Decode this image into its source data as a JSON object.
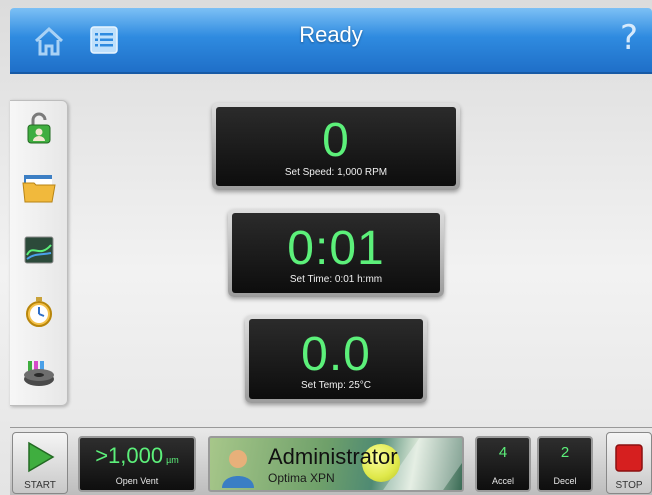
{
  "header": {
    "title": "Ready",
    "home_icon": "home-icon",
    "list_icon": "list-icon",
    "help_label": "?"
  },
  "sidebar": {
    "items": [
      {
        "name": "lock-user",
        "icon": "unlock-user-icon"
      },
      {
        "name": "files",
        "icon": "folder-icon"
      },
      {
        "name": "graph",
        "icon": "graph-icon"
      },
      {
        "name": "timer",
        "icon": "stopwatch-icon"
      },
      {
        "name": "rotor",
        "icon": "rotor-icon"
      }
    ]
  },
  "displays": {
    "speed": {
      "value": "0",
      "label": "Set Speed: 1,000 RPM"
    },
    "time": {
      "value": "0:01",
      "label": "Set Time: 0:01 h:mm"
    },
    "temp": {
      "value": "0.0",
      "label": "Set Temp: 25°C"
    }
  },
  "bottom": {
    "start_label": "START",
    "stop_label": "STOP",
    "vacuum": {
      "value": ">1,000",
      "unit": "µm",
      "label": "Open Vent"
    },
    "user": {
      "name": "Administrator",
      "instrument": "Optima XPN"
    },
    "accel": {
      "value": "4",
      "label": "Accel"
    },
    "decel": {
      "value": "2",
      "label": "Decel"
    }
  },
  "colors": {
    "display_green": "#5cf07a",
    "header_blue": "#2f8be0",
    "start_green": "#3fae3f",
    "stop_red": "#d61f1f"
  }
}
